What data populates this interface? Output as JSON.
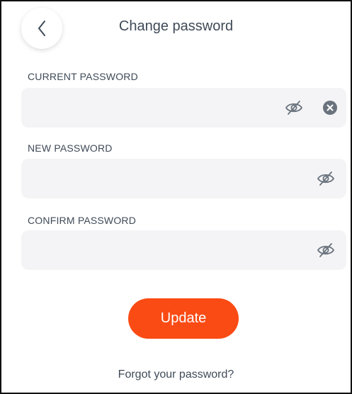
{
  "header": {
    "title": "Change password",
    "back_icon": "chevron-left-icon"
  },
  "form": {
    "fields": [
      {
        "label": "CURRENT PASSWORD",
        "value": "",
        "icons": [
          "eye-off-icon",
          "clear-icon"
        ]
      },
      {
        "label": "NEW PASSWORD",
        "value": "",
        "icons": [
          "eye-off-icon"
        ]
      },
      {
        "label": "CONFIRM PASSWORD",
        "value": "",
        "icons": [
          "eye-off-icon"
        ]
      }
    ]
  },
  "actions": {
    "update_label": "Update",
    "forgot_label": "Forgot your password?"
  },
  "colors": {
    "accent": "#fa4b14",
    "field_background": "#f4f4f6",
    "text": "#3f4a57",
    "icon": "#6a737d"
  }
}
